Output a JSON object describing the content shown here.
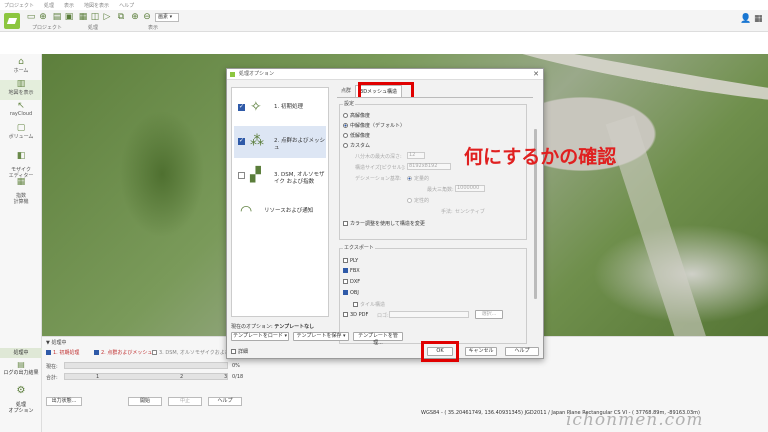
{
  "menu": [
    "プロジェクト",
    "処理",
    "表示",
    "地図を表示",
    "ヘルプ"
  ],
  "toolbar": {
    "group_project": "プロジェクト",
    "group_process": "処理",
    "group_view": "表示",
    "view_select": "画素"
  },
  "sidebar": {
    "items": [
      "ホーム",
      "地図を表示",
      "rayCloud",
      "ボリューム",
      "モザイク\nエディター",
      "指数\n計算機"
    ],
    "bottom_processing": "処理中",
    "bottom_log": "ログの出力結果",
    "bottom_options": "処理\nオプション"
  },
  "dialog": {
    "title": "処理オプション",
    "steps": [
      {
        "label": "1. 初期処理",
        "checked": true
      },
      {
        "label": "2. 点群およびメッシュ",
        "checked": true
      },
      {
        "label": "3. DSM, オルソモザイク および指数",
        "checked": false
      },
      {
        "label": "リソースおよび通知",
        "checked": null
      }
    ],
    "tabs": [
      "点群",
      "3Dメッシュ構造"
    ],
    "settings_group": "設定",
    "radios": [
      "高解像度",
      "中解像度（デフォルト）",
      "低解像度",
      "カスタム"
    ],
    "selected_radio": 1,
    "custom_fields": [
      {
        "label": "八分木の最大の深さ:",
        "value": "12"
      },
      {
        "label": "構造サイズ[ピクセル]:",
        "value": "8192x8192"
      }
    ],
    "decimation_label": "デシメーション基準:",
    "decimation_quantitative": "定量的",
    "max_triangles_label": "最大三角数:",
    "max_triangles_value": "1000000",
    "qualitative": "定性的",
    "method_label": "手法:",
    "method_value": "センシティブ",
    "color_balance": "カラー調整を使用して構造を変更",
    "export_group": "エクスポート",
    "exports": [
      {
        "label": "PLY",
        "checked": false
      },
      {
        "label": "FBX",
        "checked": true
      },
      {
        "label": "DXF",
        "checked": false
      },
      {
        "label": "OBJ",
        "checked": true
      }
    ],
    "tile_structure": "タイル構造",
    "pdf_label": "3D PDF",
    "logo_label": "ロゴ:",
    "browse_label": "選択...",
    "current_options_prefix": "現在のオプション:",
    "current_options_value": "テンプレートなし",
    "template_load": "テンプレートをロード",
    "template_save": "テンプレートを保存",
    "template_manage": "テンプレートを管理...",
    "advanced": "詳細",
    "ok": "OK",
    "cancel": "キャンセル",
    "help": "ヘルプ"
  },
  "annotation": "何にするかの確認",
  "bottom": {
    "header": "処理中",
    "steps": [
      "1. 初期処理",
      "2. 点群およびメッシュ",
      "3. DSM, オルソモザイクおよび指数"
    ],
    "current_label": "現在:",
    "current_value": "0%",
    "total_label": "合計:",
    "total_marks": [
      "1",
      "2",
      "3"
    ],
    "total_value": "0/18",
    "output_status": "出力状態...",
    "start": "開始",
    "stop": "中止",
    "help": "ヘルプ",
    "coords": "WGS84 - ( 35.20461749, 136.40931345)  JGD2011 / Japan Plane Rectangular CS VI - ( 37768.89m, -89163.03m)"
  },
  "watermark": "ichonmen.com"
}
